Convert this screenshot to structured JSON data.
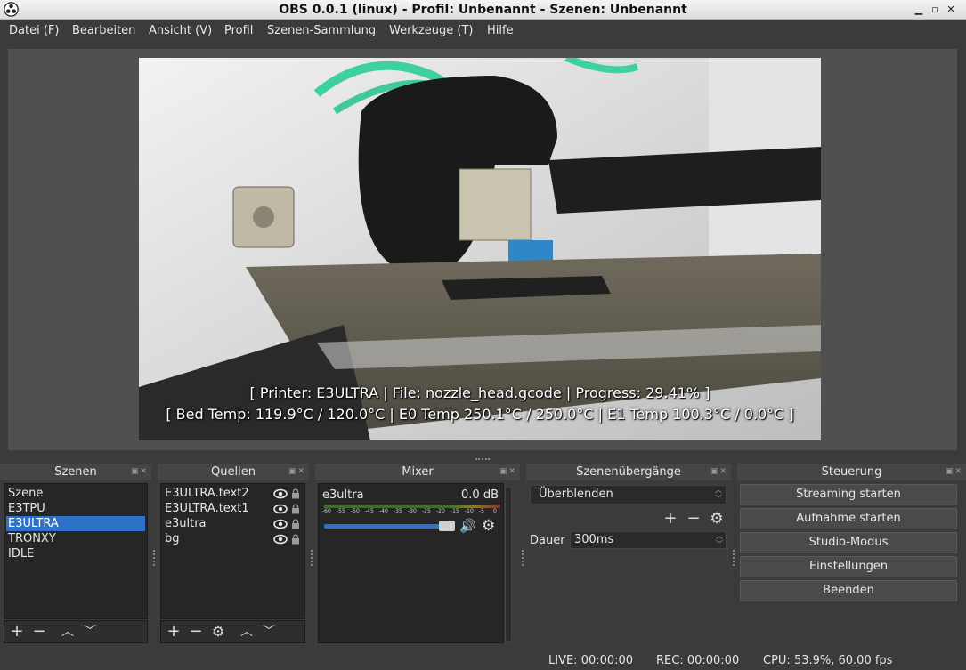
{
  "window": {
    "title": "OBS 0.0.1 (linux) - Profil: Unbenannt - Szenen: Unbenannt"
  },
  "menu": {
    "items": [
      {
        "label": "Datei (F)"
      },
      {
        "label": "Bearbeiten"
      },
      {
        "label": "Ansicht (V)"
      },
      {
        "label": "Profil"
      },
      {
        "label": "Szenen-Sammlung"
      },
      {
        "label": "Werkzeuge (T)"
      },
      {
        "label": "Hilfe"
      }
    ]
  },
  "preview": {
    "overlay_line1": "[ Printer: E3ULTRA | File: nozzle_head.gcode | Progress: 29.41% ]",
    "overlay_line2": "[ Bed Temp: 119.9°C / 120.0°C | E0 Temp 250.1°C / 250.0°C | E1 Temp 100.3°C / 0.0°C ]"
  },
  "scenes": {
    "title": "Szenen",
    "items": [
      "Szene",
      "E3TPU",
      "E3ULTRA",
      "TRONXY",
      "IDLE"
    ],
    "selected": "E3ULTRA"
  },
  "sources": {
    "title": "Quellen",
    "items": [
      "E3ULTRA.text2",
      "E3ULTRA.text1",
      "e3ultra",
      "bg"
    ]
  },
  "mixer": {
    "title": "Mixer",
    "channel": "e3ultra",
    "level": "0.0 dB",
    "scale": [
      "-60",
      "-55",
      "-50",
      "-45",
      "-40",
      "-35",
      "-30",
      "-25",
      "-20",
      "-15",
      "-10",
      "-5",
      "0"
    ],
    "volume_fraction": 1.0
  },
  "transitions": {
    "title": "Szenenübergänge",
    "selected": "Überblenden",
    "duration_label": "Dauer",
    "duration_value": "300ms"
  },
  "controls": {
    "title": "Steuerung",
    "streaming": "Streaming starten",
    "recording": "Aufnahme starten",
    "studio": "Studio-Modus",
    "settings": "Einstellungen",
    "quit": "Beenden"
  },
  "status": {
    "live": "LIVE: 00:00:00",
    "rec": "REC: 00:00:00",
    "cpu": "CPU: 53.9%, 60.00 fps"
  },
  "colors": {
    "accent": "#2d72c8",
    "background": "#3b3b3b"
  }
}
